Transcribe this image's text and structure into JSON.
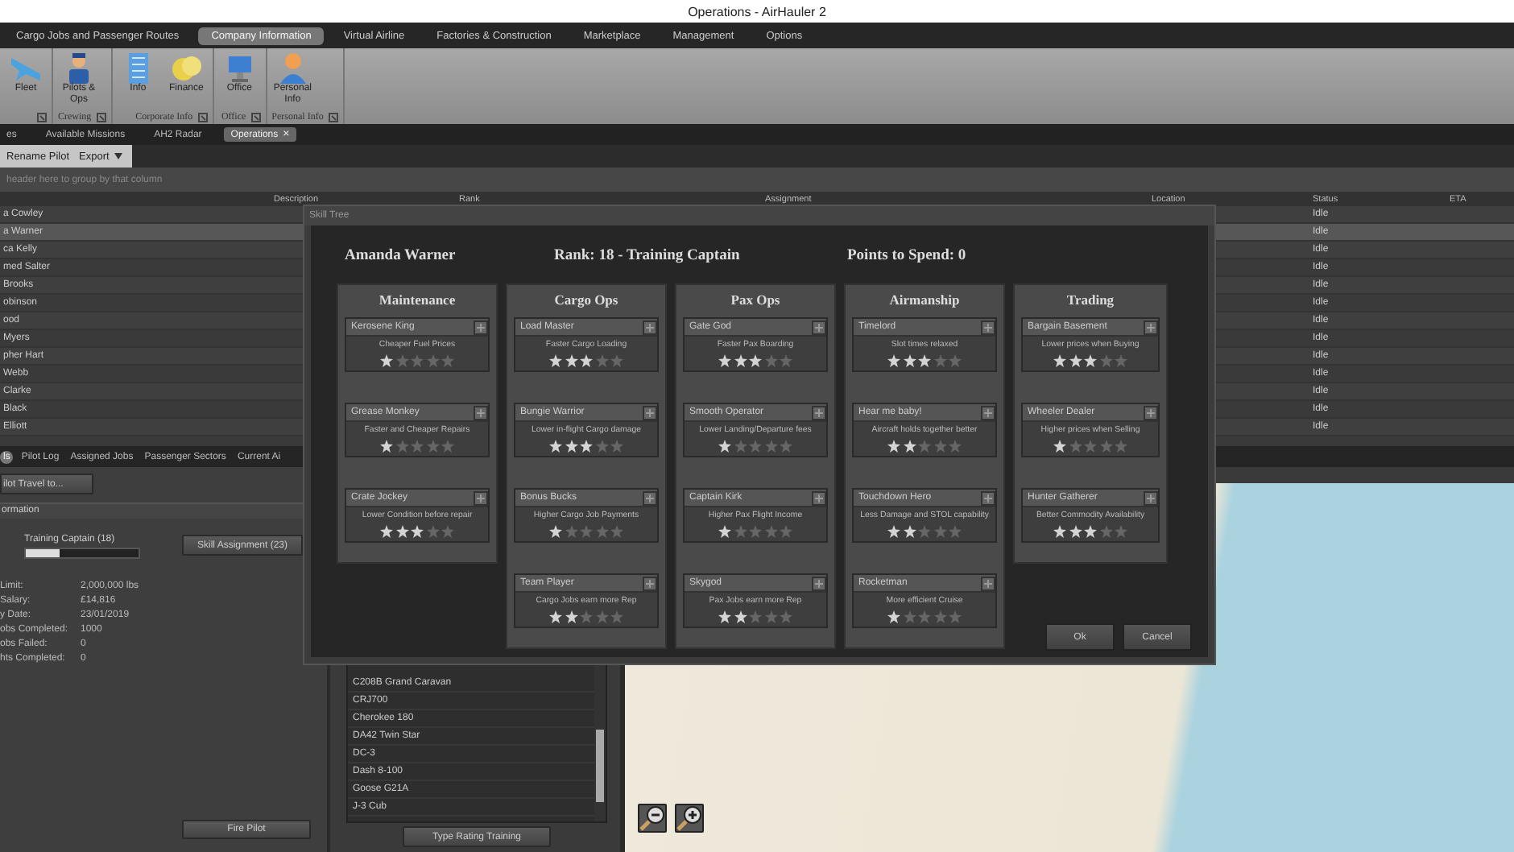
{
  "window": {
    "title": "Operations - AirHauler 2"
  },
  "ribbon": {
    "tabs": [
      {
        "label": "Cargo Jobs and Passenger Routes",
        "selected": false
      },
      {
        "label": "Company Information",
        "selected": true
      },
      {
        "label": "Virtual Airline",
        "selected": false
      },
      {
        "label": "Factories & Construction",
        "selected": false
      },
      {
        "label": "Marketplace",
        "selected": false
      },
      {
        "label": "Management",
        "selected": false
      },
      {
        "label": "Options",
        "selected": false
      }
    ],
    "groups": [
      {
        "buttons": [
          {
            "label": "Fleet",
            "kind": "plane"
          }
        ]
      },
      {
        "label": "Crewing",
        "buttons": [
          {
            "label": "Pilots & Ops",
            "kind": "pilot"
          }
        ]
      },
      {
        "label": "Corporate Info",
        "buttons": [
          {
            "label": "Info",
            "kind": "building"
          },
          {
            "label": "Finance",
            "kind": "coins"
          }
        ]
      },
      {
        "label": "Office",
        "buttons": [
          {
            "label": "Office",
            "kind": "monitor"
          }
        ]
      },
      {
        "label": "Personal Info",
        "buttons": [
          {
            "label": "Personal Info",
            "kind": "person"
          }
        ]
      }
    ]
  },
  "document_tabs": [
    {
      "label": "es",
      "selected": false
    },
    {
      "label": "Available Missions",
      "selected": false
    },
    {
      "label": "AH2 Radar",
      "selected": false
    },
    {
      "label": "Operations",
      "selected": true,
      "close": "×"
    }
  ],
  "toolbar": {
    "buttons": [
      {
        "label": "Rename Pilot",
        "kind": "plain"
      },
      {
        "label": "Export",
        "kind": "dropdown"
      }
    ]
  },
  "group_panel": {
    "hint": "header here to group by that column"
  },
  "table": {
    "columns": [
      "Description",
      "Rank",
      "Assignment",
      "Location",
      "Status",
      "ETA"
    ],
    "rows": [
      {
        "column_1": "a Cowley",
        "status": "Idle",
        "selected": false
      },
      {
        "column_1": "a Warner",
        "status": "Idle",
        "selected": true
      },
      {
        "column_1": "ca Kelly",
        "status": "Idle",
        "selected": false
      },
      {
        "column_1": "med Salter",
        "status": "Idle",
        "selected": false
      },
      {
        "column_1": "Brooks",
        "status": "Idle",
        "selected": false
      },
      {
        "column_1": "obinson",
        "status": "Idle",
        "selected": false
      },
      {
        "column_1": "ood",
        "status": "Idle",
        "selected": false
      },
      {
        "column_1": "Myers",
        "status": "Idle",
        "selected": false
      },
      {
        "column_1": "pher Hart",
        "status": "Idle",
        "selected": false
      },
      {
        "column_1": "Webb",
        "status": "Idle",
        "selected": false
      },
      {
        "column_1": "Clarke",
        "status": "Idle",
        "selected": false
      },
      {
        "column_1": "Black",
        "status": "Idle",
        "selected": false
      },
      {
        "column_1": "Elliott",
        "status": "Idle",
        "selected": false
      }
    ]
  },
  "bottom_tabs": [
    {
      "label": "ls",
      "selected": true
    },
    {
      "label": "Pilot Log",
      "selected": false
    },
    {
      "label": "Assigned Jobs",
      "selected": false
    },
    {
      "label": "Passenger Sectors",
      "selected": false
    },
    {
      "label": "Current Ai",
      "selected": false
    }
  ],
  "pilot_panel": {
    "travel_button": "ilot Travel to...",
    "section": "ormation",
    "rank_label": "Training Captain (18)",
    "rank_progress": {
      "level": 0.3
    },
    "skill_button": "Skill Assignment (23)",
    "fields": [
      {
        "label": "Limit:",
        "value": "2,000,000 lbs"
      },
      {
        "label": "Salary:",
        "value": "£14,816"
      },
      {
        "label": "y Date:",
        "value": "23/01/2019"
      },
      {
        "label": "obs Completed:",
        "value": "1000"
      },
      {
        "label": "obs Failed:",
        "value": "0"
      },
      {
        "label": "hts Completed:",
        "value": "0"
      }
    ],
    "fire_button": "Fire Pilot"
  },
  "aircraft_list": {
    "items": [
      "C208B Grand Caravan",
      "CRJ700",
      "Cherokee 180",
      "DA42 Twin Star",
      "DC-3",
      "Dash 8-100",
      "Goose G21A",
      "J-3 Cub"
    ],
    "button": "Type Rating Training"
  },
  "skill_tree": {
    "title": "Skill Tree",
    "pilot": "Amanda Warner",
    "rank": "Rank: 18 - Training Captain",
    "points": "Points to Spend: 0",
    "categories": [
      {
        "name": "Maintenance",
        "skills": [
          {
            "name": "Kerosene King",
            "description": "Cheaper Fuel Prices",
            "stars": 1
          },
          {
            "name": "Grease Monkey",
            "description": "Faster and Cheaper Repairs",
            "stars": 1
          },
          {
            "name": "Crate Jockey",
            "description": "Lower Condition before repair",
            "stars": 3
          }
        ]
      },
      {
        "name": "Cargo Ops",
        "skills": [
          {
            "name": "Load Master",
            "description": "Faster Cargo Loading",
            "stars": 3
          },
          {
            "name": "Bungie Warrior",
            "description": "Lower in-flight Cargo damage",
            "stars": 3
          },
          {
            "name": "Bonus Bucks",
            "description": "Higher Cargo Job Payments",
            "stars": 1
          },
          {
            "name": "Team Player",
            "description": "Cargo Jobs earn more Rep",
            "stars": 2
          }
        ]
      },
      {
        "name": "Pax Ops",
        "skills": [
          {
            "name": "Gate God",
            "description": "Faster Pax Boarding",
            "stars": 3
          },
          {
            "name": "Smooth Operator",
            "description": "Lower Landing/Departure fees",
            "stars": 1
          },
          {
            "name": "Captain Kirk",
            "description": "Higher Pax Flight Income",
            "stars": 1
          },
          {
            "name": "Skygod",
            "description": "Pax Jobs earn more Rep",
            "stars": 2
          }
        ]
      },
      {
        "name": "Airmanship",
        "skills": [
          {
            "name": "Timelord",
            "description": "Slot times relaxed",
            "stars": 3
          },
          {
            "name": "Hear me baby!",
            "description": "Aircraft holds together better",
            "stars": 2
          },
          {
            "name": "Touchdown Hero",
            "description": "Less Damage and STOL capability",
            "stars": 2
          },
          {
            "name": "Rocketman",
            "description": "More efficient Cruise",
            "stars": 1
          }
        ]
      },
      {
        "name": "Trading",
        "skills": [
          {
            "name": "Bargain Basement",
            "description": "Lower prices when Buying",
            "stars": 3
          },
          {
            "name": "Wheeler Dealer",
            "description": "Higher prices when Selling",
            "stars": 1
          },
          {
            "name": "Hunter Gatherer",
            "description": "Better Commodity Availability",
            "stars": 3
          }
        ]
      }
    ],
    "buttons": [
      "Ok",
      "Cancel"
    ]
  }
}
